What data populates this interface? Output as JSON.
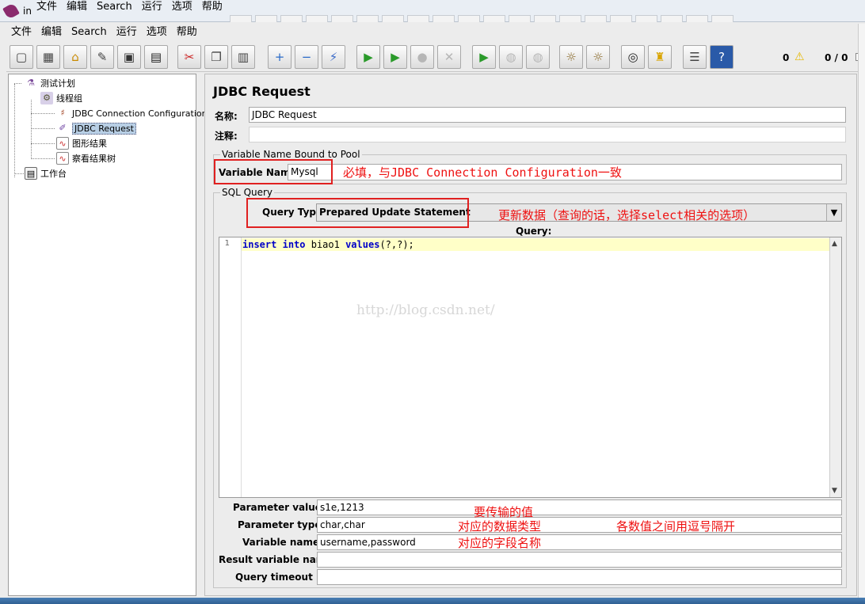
{
  "bg_window": {
    "title_fragment": "in",
    "menu": [
      "文件",
      "编辑",
      "Search",
      "运行",
      "选项",
      "帮助"
    ]
  },
  "menu": [
    "文件",
    "编辑",
    "Search",
    "运行",
    "选项",
    "帮助"
  ],
  "toolbar": {
    "buttons": [
      {
        "name": "new-icon",
        "glyph": "▢"
      },
      {
        "name": "templates-icon",
        "glyph": "▦"
      },
      {
        "name": "open-icon",
        "glyph": "⌂"
      },
      {
        "name": "close-icon",
        "glyph": "✎"
      },
      {
        "name": "save-icon",
        "glyph": "▣"
      },
      {
        "name": "save-as-icon",
        "glyph": "▤"
      },
      {
        "name": "cut-icon",
        "glyph": "✂"
      },
      {
        "name": "copy-icon",
        "glyph": "❐"
      },
      {
        "name": "paste-icon",
        "glyph": "▥"
      },
      {
        "name": "expand-icon",
        "glyph": "+"
      },
      {
        "name": "collapse-icon",
        "glyph": "−"
      },
      {
        "name": "toggle-icon",
        "glyph": "⚡"
      },
      {
        "name": "start-icon",
        "glyph": "▶"
      },
      {
        "name": "start-no-pause-icon",
        "glyph": "▶"
      },
      {
        "name": "stop-icon",
        "glyph": "●"
      },
      {
        "name": "shutdown-icon",
        "glyph": "✕"
      },
      {
        "name": "remote-start-icon",
        "glyph": "▶"
      },
      {
        "name": "remote-stop-icon",
        "glyph": "◍"
      },
      {
        "name": "remote-shutdown-icon",
        "glyph": "◍"
      },
      {
        "name": "clear-icon",
        "glyph": "☼"
      },
      {
        "name": "clear-all-icon",
        "glyph": "☼"
      },
      {
        "name": "search-icon",
        "glyph": "◎"
      },
      {
        "name": "reset-search-icon",
        "glyph": "♜"
      },
      {
        "name": "function-helper-icon",
        "glyph": "☰"
      },
      {
        "name": "help-icon",
        "glyph": "?"
      }
    ],
    "warnings_count": "0",
    "threads": "0 / 0"
  },
  "tree": {
    "nodes": [
      {
        "label": "测试计划",
        "icon": "test-plan-icon"
      },
      {
        "label": "线程组",
        "icon": "thread-group-icon"
      },
      {
        "label": "JDBC Connection Configuration",
        "icon": "jdbc-config-icon"
      },
      {
        "label": "JDBC Request",
        "icon": "jdbc-request-icon"
      },
      {
        "label": "图形结果",
        "icon": "graph-results-icon"
      },
      {
        "label": "察看结果树",
        "icon": "results-tree-icon"
      },
      {
        "label": "工作台",
        "icon": "workbench-icon"
      }
    ]
  },
  "panel": {
    "title": "JDBC Request",
    "name_label": "名称:",
    "name_value": "JDBC Request",
    "comment_label": "注释:",
    "comment_value": "",
    "pool_group": "Variable Name Bound to Pool",
    "var_name_label": "Variable Name:",
    "var_name_value": "Mysql",
    "sql_group": "SQL Query",
    "query_type_label": "Query Type:",
    "query_type_value": "Prepared Update Statement",
    "query_label": "Query:",
    "line_number": "1",
    "query_text_parts": [
      "insert",
      " ",
      "into",
      " biao1 ",
      "values",
      "(?,?);"
    ],
    "param_values_label": "Parameter values:",
    "param_values": "s1e,1213",
    "param_types_label": "Parameter types:",
    "param_types": "char,char",
    "var_names_label": "Variable names:",
    "var_names": "username,password",
    "result_var_label": "Result variable name:",
    "result_var": "",
    "timeout_label": "Query timeout (s):",
    "timeout": ""
  },
  "annotations": {
    "var_name": "必填，与JDBC Connection Configuration一致",
    "query_type": "更新数据（查询的话，选择select相关的选项）",
    "param_values": "要传输的值",
    "param_types": "对应的数据类型",
    "comma_note": "各数值之间用逗号隔开",
    "var_names": "对应的字段名称"
  },
  "watermark": "http://blog.csdn.net/",
  "colors": {
    "annotation": "#e11111",
    "highlight_box": "#e02020",
    "keyword": "#0000c8"
  }
}
